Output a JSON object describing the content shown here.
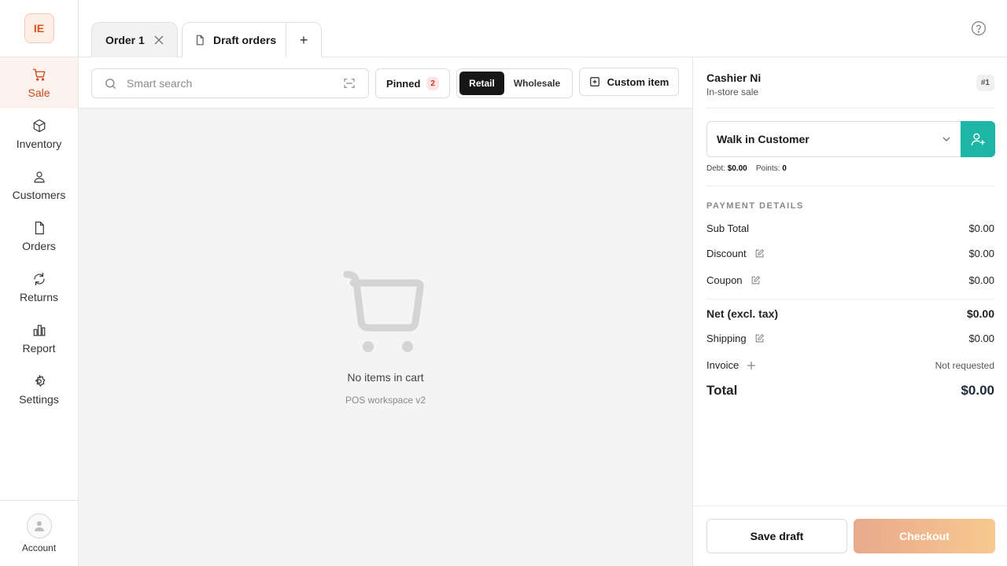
{
  "app": {
    "logo_text": "IE"
  },
  "sidebar": {
    "items": [
      {
        "label": "Sale",
        "icon": "cart-icon",
        "active": true
      },
      {
        "label": "Inventory",
        "icon": "box-icon"
      },
      {
        "label": "Customers",
        "icon": "user-icon"
      },
      {
        "label": "Orders",
        "icon": "file-icon"
      },
      {
        "label": "Returns",
        "icon": "refresh-icon"
      },
      {
        "label": "Report",
        "icon": "bar-chart-icon"
      },
      {
        "label": "Settings",
        "icon": "gear-icon"
      }
    ],
    "account_label": "Account"
  },
  "tabs": {
    "order": "Order 1",
    "draft": "Draft orders",
    "add": "+"
  },
  "toolbar": {
    "search_placeholder": "Smart search",
    "pinned_label": "Pinned",
    "pinned_count": "2",
    "mode_retail": "Retail",
    "mode_wholesale": "Wholesale",
    "mode_selected": "Retail",
    "custom_item": "Custom item"
  },
  "cart": {
    "empty_message": "No items in cart",
    "workspace_label": "POS workspace v2"
  },
  "checkout_panel": {
    "cashier_name": "Cashier Ni",
    "sale_type": "In-store sale",
    "order_number": "#1",
    "customer": "Walk in Customer",
    "debt_label": "Debt:",
    "debt_value": "$0.00",
    "points_label": "Points:",
    "points_value": "0",
    "section_title": "PAYMENT DETAILS",
    "subtotal_label": "Sub Total",
    "subtotal_value": "$0.00",
    "discount_label": "Discount",
    "discount_value": "$0.00",
    "coupon_label": "Coupon",
    "coupon_value": "$0.00",
    "net_label": "Net (excl. tax)",
    "net_value": "$0.00",
    "shipping_label": "Shipping",
    "shipping_value": "$0.00",
    "invoice_label": "Invoice",
    "invoice_value": "Not requested",
    "total_label": "Total",
    "total_value": "$0.00",
    "save_draft": "Save draft",
    "checkout": "Checkout"
  },
  "colors": {
    "accent": "#c9461a",
    "teal": "#1db5a5",
    "checkout_gradient_start": "#e9a98c",
    "checkout_gradient_end": "#f7c98f"
  }
}
